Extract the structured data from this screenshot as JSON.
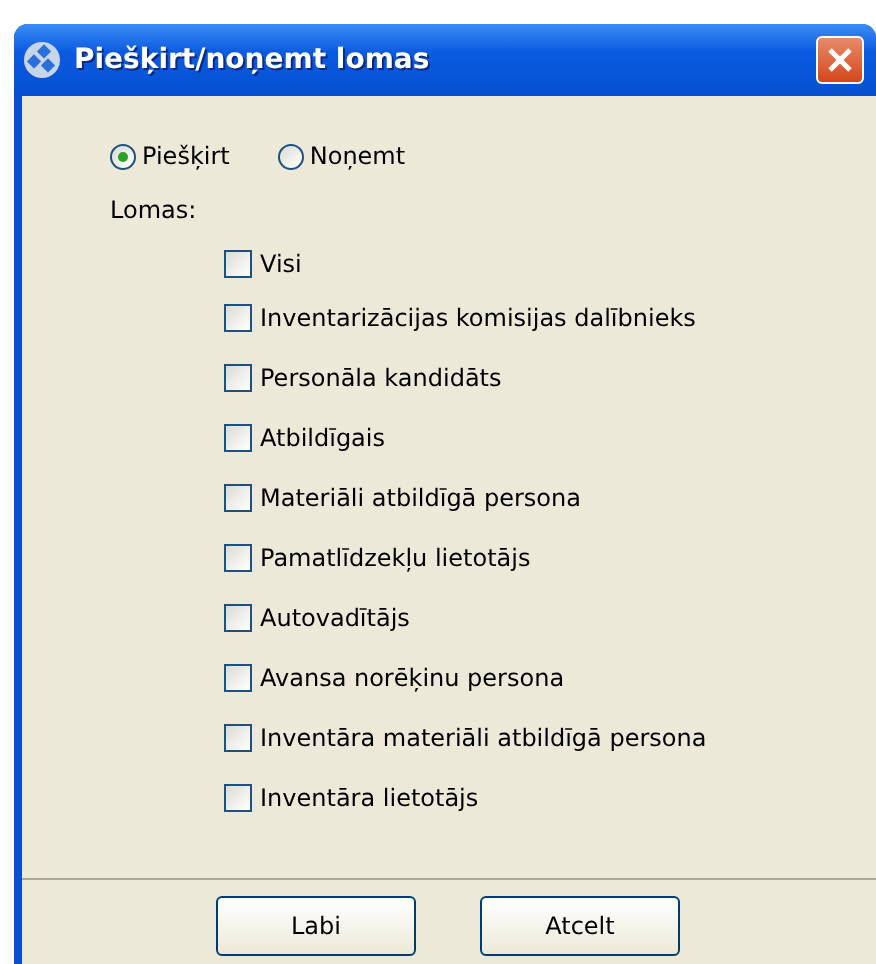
{
  "window": {
    "title": "Piešķirt/noņemt lomas"
  },
  "mode": [
    {
      "label": "Piešķirt",
      "selected": true
    },
    {
      "label": "Noņemt",
      "selected": false
    }
  ],
  "roles_label": "Lomas:",
  "roles": [
    {
      "label": "Visi",
      "checked": false
    },
    {
      "label": "Inventarizācijas komisijas dalībnieks",
      "checked": false
    },
    {
      "label": "Personāla kandidāts",
      "checked": false
    },
    {
      "label": "Atbildīgais",
      "checked": false
    },
    {
      "label": "Materiāli atbildīgā persona",
      "checked": false
    },
    {
      "label": "Pamatlīdzekļu lietotājs",
      "checked": false
    },
    {
      "label": "Autovadītājs",
      "checked": false
    },
    {
      "label": "Avansa norēķinu persona",
      "checked": false
    },
    {
      "label": "Inventāra materiāli atbildīgā persona",
      "checked": false
    },
    {
      "label": "Inventāra lietotājs",
      "checked": false
    }
  ],
  "buttons": [
    "Labi",
    "Atcelt"
  ]
}
